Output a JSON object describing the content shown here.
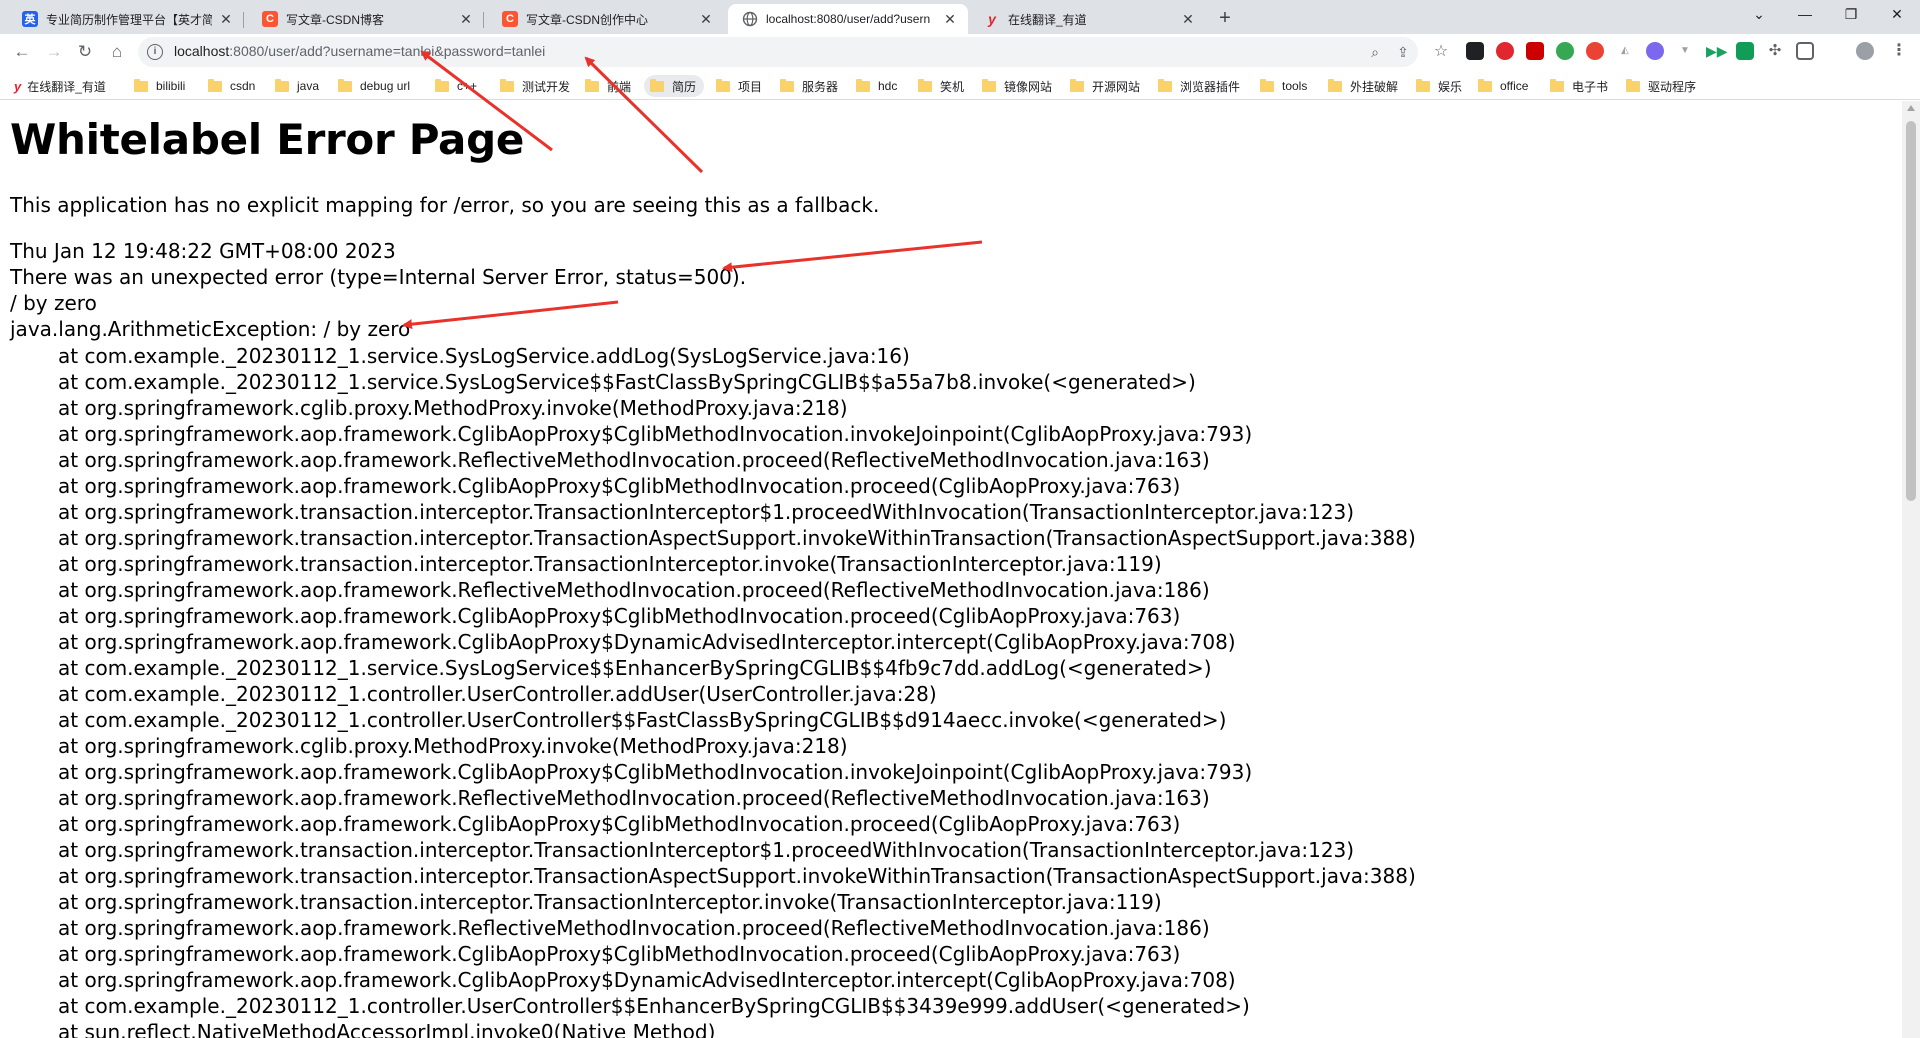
{
  "tabs": [
    {
      "title": "专业简历制作管理平台【英才简...",
      "favicon": "英",
      "favicon_color": "#2563eb",
      "active": false
    },
    {
      "title": "写文章-CSDN博客",
      "favicon": "C",
      "favicon_color": "#fc5531",
      "active": false
    },
    {
      "title": "写文章-CSDN创作中心",
      "favicon": "C",
      "favicon_color": "#fc5531",
      "active": false
    },
    {
      "title": "localhost:8080/user/add?usern",
      "favicon": "globe",
      "favicon_color": "#5f6368",
      "active": true
    },
    {
      "title": "在线翻译_有道",
      "favicon": "y",
      "favicon_color": "#e0262f",
      "active": false
    }
  ],
  "toolbar": {
    "url_host": "localhost",
    "url_rest": ":8080/user/add?username=tanlei&password=tanlei"
  },
  "bookmarks": [
    {
      "label": "在线翻译_有道",
      "icon": "youdao"
    },
    {
      "label": "bilibili",
      "icon": "folder"
    },
    {
      "label": "csdn",
      "icon": "folder"
    },
    {
      "label": "java",
      "icon": "folder"
    },
    {
      "label": "debug url",
      "icon": "folder"
    },
    {
      "label": "c++",
      "icon": "folder"
    },
    {
      "label": "测试开发",
      "icon": "folder"
    },
    {
      "label": "前端",
      "icon": "folder"
    },
    {
      "label": "简历",
      "icon": "folder"
    },
    {
      "label": "项目",
      "icon": "folder"
    },
    {
      "label": "服务器",
      "icon": "folder"
    },
    {
      "label": "hdc",
      "icon": "folder"
    },
    {
      "label": "笑机",
      "icon": "folder"
    },
    {
      "label": "镜像网站",
      "icon": "folder"
    },
    {
      "label": "开源网站",
      "icon": "folder"
    },
    {
      "label": "浏览器插件",
      "icon": "folder"
    },
    {
      "label": "tools",
      "icon": "folder"
    },
    {
      "label": "外挂破解",
      "icon": "folder"
    },
    {
      "label": "娱乐",
      "icon": "folder"
    },
    {
      "label": "office",
      "icon": "folder"
    },
    {
      "label": "电子书",
      "icon": "folder"
    },
    {
      "label": "驱动程序",
      "icon": "folder"
    }
  ],
  "page": {
    "heading": "Whitelabel Error Page",
    "fallback_text": "This application has no explicit mapping for /error, so you are seeing this as a fallback.",
    "timestamp": "Thu Jan 12 19:48:22 GMT+08:00 2023",
    "error_summary": "There was an unexpected error (type=Internal Server Error, status=500).",
    "message": "/ by zero",
    "exception": "java.lang.ArithmeticException: / by zero",
    "stack_trace": [
      "at com.example._20230112_1.service.SysLogService.addLog(SysLogService.java:16)",
      "at com.example._20230112_1.service.SysLogService$$FastClassBySpringCGLIB$$a55a7b8.invoke(<generated>)",
      "at org.springframework.cglib.proxy.MethodProxy.invoke(MethodProxy.java:218)",
      "at org.springframework.aop.framework.CglibAopProxy$CglibMethodInvocation.invokeJoinpoint(CglibAopProxy.java:793)",
      "at org.springframework.aop.framework.ReflectiveMethodInvocation.proceed(ReflectiveMethodInvocation.java:163)",
      "at org.springframework.aop.framework.CglibAopProxy$CglibMethodInvocation.proceed(CglibAopProxy.java:763)",
      "at org.springframework.transaction.interceptor.TransactionInterceptor$1.proceedWithInvocation(TransactionInterceptor.java:123)",
      "at org.springframework.transaction.interceptor.TransactionAspectSupport.invokeWithinTransaction(TransactionAspectSupport.java:388)",
      "at org.springframework.transaction.interceptor.TransactionInterceptor.invoke(TransactionInterceptor.java:119)",
      "at org.springframework.aop.framework.ReflectiveMethodInvocation.proceed(ReflectiveMethodInvocation.java:186)",
      "at org.springframework.aop.framework.CglibAopProxy$CglibMethodInvocation.proceed(CglibAopProxy.java:763)",
      "at org.springframework.aop.framework.CglibAopProxy$DynamicAdvisedInterceptor.intercept(CglibAopProxy.java:708)",
      "at com.example._20230112_1.service.SysLogService$$EnhancerBySpringCGLIB$$4fb9c7dd.addLog(<generated>)",
      "at com.example._20230112_1.controller.UserController.addUser(UserController.java:28)",
      "at com.example._20230112_1.controller.UserController$$FastClassBySpringCGLIB$$d914aecc.invoke(<generated>)",
      "at org.springframework.cglib.proxy.MethodProxy.invoke(MethodProxy.java:218)",
      "at org.springframework.aop.framework.CglibAopProxy$CglibMethodInvocation.invokeJoinpoint(CglibAopProxy.java:793)",
      "at org.springframework.aop.framework.ReflectiveMethodInvocation.proceed(ReflectiveMethodInvocation.java:163)",
      "at org.springframework.aop.framework.CglibAopProxy$CglibMethodInvocation.proceed(CglibAopProxy.java:763)",
      "at org.springframework.transaction.interceptor.TransactionInterceptor$1.proceedWithInvocation(TransactionInterceptor.java:123)",
      "at org.springframework.transaction.interceptor.TransactionAspectSupport.invokeWithinTransaction(TransactionAspectSupport.java:388)",
      "at org.springframework.transaction.interceptor.TransactionInterceptor.invoke(TransactionInterceptor.java:119)",
      "at org.springframework.aop.framework.ReflectiveMethodInvocation.proceed(ReflectiveMethodInvocation.java:186)",
      "at org.springframework.aop.framework.CglibAopProxy$CglibMethodInvocation.proceed(CglibAopProxy.java:763)",
      "at org.springframework.aop.framework.CglibAopProxy$DynamicAdvisedInterceptor.intercept(CglibAopProxy.java:708)",
      "at com.example._20230112_1.controller.UserController$$EnhancerBySpringCGLIB$$3439e999.addUser(<generated>)",
      "at sun.reflect.NativeMethodAccessorImpl.invoke0(Native Method)"
    ]
  },
  "colors": {
    "annotation_arrow": "#e8322b",
    "tabstrip_bg": "#dee1e6",
    "omnibox_bg": "#f1f3f4"
  }
}
